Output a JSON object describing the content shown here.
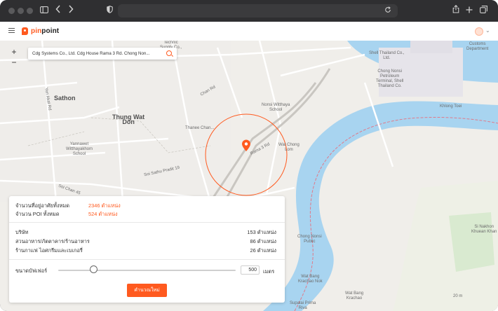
{
  "app": {
    "logo_pre": "pin",
    "logo_post": "point"
  },
  "search": {
    "value": "Cdg Systems Co., Ltd. Cdg House Rama 3 Rd. Chong Non..."
  },
  "map": {
    "zoom_in": "+",
    "zoom_out": "−",
    "labels": {
      "technic": "Technic\nSupply Co.,\nLtd.",
      "shell_thailand": "Shell Thailand Co.,\nLtd.",
      "customs": "Customs\nDepartment",
      "chong_nonsi_pet": "Chong Nonsi\nPetroleum\nTerminal, Shell\nThailand Co.",
      "sathon": "Sathon",
      "thung_wat_don": "Thung Wat\nDon",
      "khlong_toei": "Khlong Toei",
      "nonsi_witthaya": "Nonsi Witthaya\nSchool",
      "yannawet": "Yannawet\nWitthayakhom\nSchool",
      "wat_chong_lom": "Wat Chong\nLom",
      "chong_nonsi_public": "Chong Nonsi\nPublic",
      "wat_bang_krachao": "Wat Bang\nKrachao Nok",
      "si_nakhon": "Si Nakhon\nKhuean Khan",
      "supalai": "Supalai Prima\nRiva",
      "wat_bang_khrachao": "Wat Bang\nKrachao",
      "elev": "20 m",
      "ram3_rd": "Rama 3 Rd",
      "yen_akat": "Yen Akat Rd",
      "soi_sathu": "Soi Sathu Pradit 19",
      "chan_rd": "Chan Rd",
      "soi_chan": "Soi Chan 45",
      "thana": "Thanee Chan..."
    }
  },
  "panel": {
    "residence_label": "จำนวนที่อยู่อาศัยทั้งหมด",
    "residence_value": "2346 ตำแหน่ง",
    "poi_label": "จำนวน POI ทั้งหมด",
    "poi_value": "524 ตำแหน่ง",
    "categories": [
      {
        "name": "บริษัท",
        "count": "153 ตำแหน่ง"
      },
      {
        "name": "สวนอาหาร/ภัตตาคาร/ร้านอาหาร",
        "count": "86 ตำแหน่ง"
      },
      {
        "name": "ร้านกาแฟ ไอศกรีมและเบเกอรี่",
        "count": "26 ตำแหน่ง"
      }
    ],
    "buffer_label": "ขนาดบัฟเฟอร์",
    "buffer_value": "500",
    "buffer_unit": "เมตร",
    "calc_button": "คำนวณใหม่",
    "buffer_level": 0.2
  }
}
